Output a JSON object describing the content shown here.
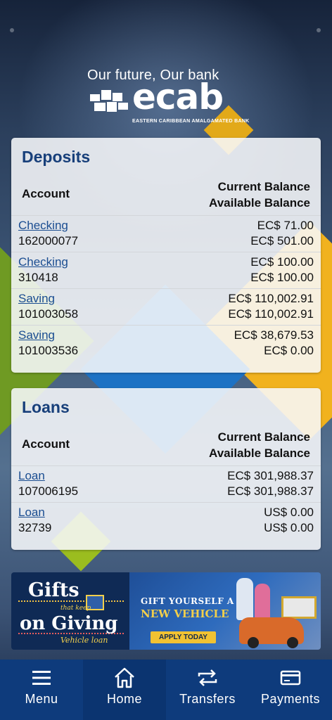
{
  "brand": {
    "tagline": "Our future, Our bank",
    "name": "ecab",
    "subtitle": "EASTERN CARIBBEAN AMALGAMATED BANK"
  },
  "deposits": {
    "title": "Deposits",
    "col_account": "Account",
    "col_current": "Current Balance",
    "col_available": "Available Balance",
    "rows": [
      {
        "type": "Checking",
        "number": "162000077",
        "current": "EC$ 71.00",
        "available": "EC$ 501.00"
      },
      {
        "type": "Checking",
        "number": "310418",
        "current": "EC$ 100.00",
        "available": "EC$ 100.00"
      },
      {
        "type": "Saving",
        "number": "101003058",
        "current": "EC$ 110,002.91",
        "available": "EC$ 110,002.91"
      },
      {
        "type": "Saving",
        "number": "101003536",
        "current": "EC$ 38,679.53",
        "available": "EC$ 0.00"
      }
    ]
  },
  "loans": {
    "title": "Loans",
    "col_account": "Account",
    "col_current": "Current Balance",
    "col_available": "Available Balance",
    "rows": [
      {
        "type": "Loan",
        "number": "107006195",
        "current": "EC$ 301,988.37",
        "available": "EC$ 301,988.37"
      },
      {
        "type": "Loan",
        "number": "32739",
        "current": "US$ 0.00",
        "available": "US$ 0.00"
      }
    ]
  },
  "banner": {
    "gifts": "Gifts",
    "that_keep": "that keep",
    "on_giving": "on Giving",
    "vehicle_loan": "Vehicle loan",
    "gift_yourself": "GIFT YOURSELF A",
    "new_vehicle": "NEW VEHICLE",
    "apply": "APPLY TODAY"
  },
  "nav": {
    "items": [
      {
        "label": "Menu",
        "icon": "menu-icon"
      },
      {
        "label": "Home",
        "icon": "home-icon"
      },
      {
        "label": "Transfers",
        "icon": "transfers-icon"
      },
      {
        "label": "Payments",
        "icon": "payments-icon"
      }
    ]
  },
  "colors": {
    "accent": "#173f7a",
    "link": "#1a4d91",
    "nav_bg": "#0e3b7c"
  }
}
